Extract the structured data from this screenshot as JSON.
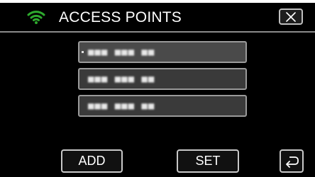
{
  "header": {
    "title": "ACCESS POINTS",
    "wifi_icon": "wifi-icon",
    "close_icon": "close-icon",
    "accent_color": "#2eaa2e"
  },
  "access_points": [
    {
      "label": "■■■ ■■■ ■■",
      "selected": true
    },
    {
      "label": "■■■ ■■■ ■■",
      "selected": false
    },
    {
      "label": "■■■ ■■■ ■■",
      "selected": false
    }
  ],
  "footer": {
    "add_label": "ADD",
    "set_label": "SET",
    "back_icon": "back-icon"
  }
}
